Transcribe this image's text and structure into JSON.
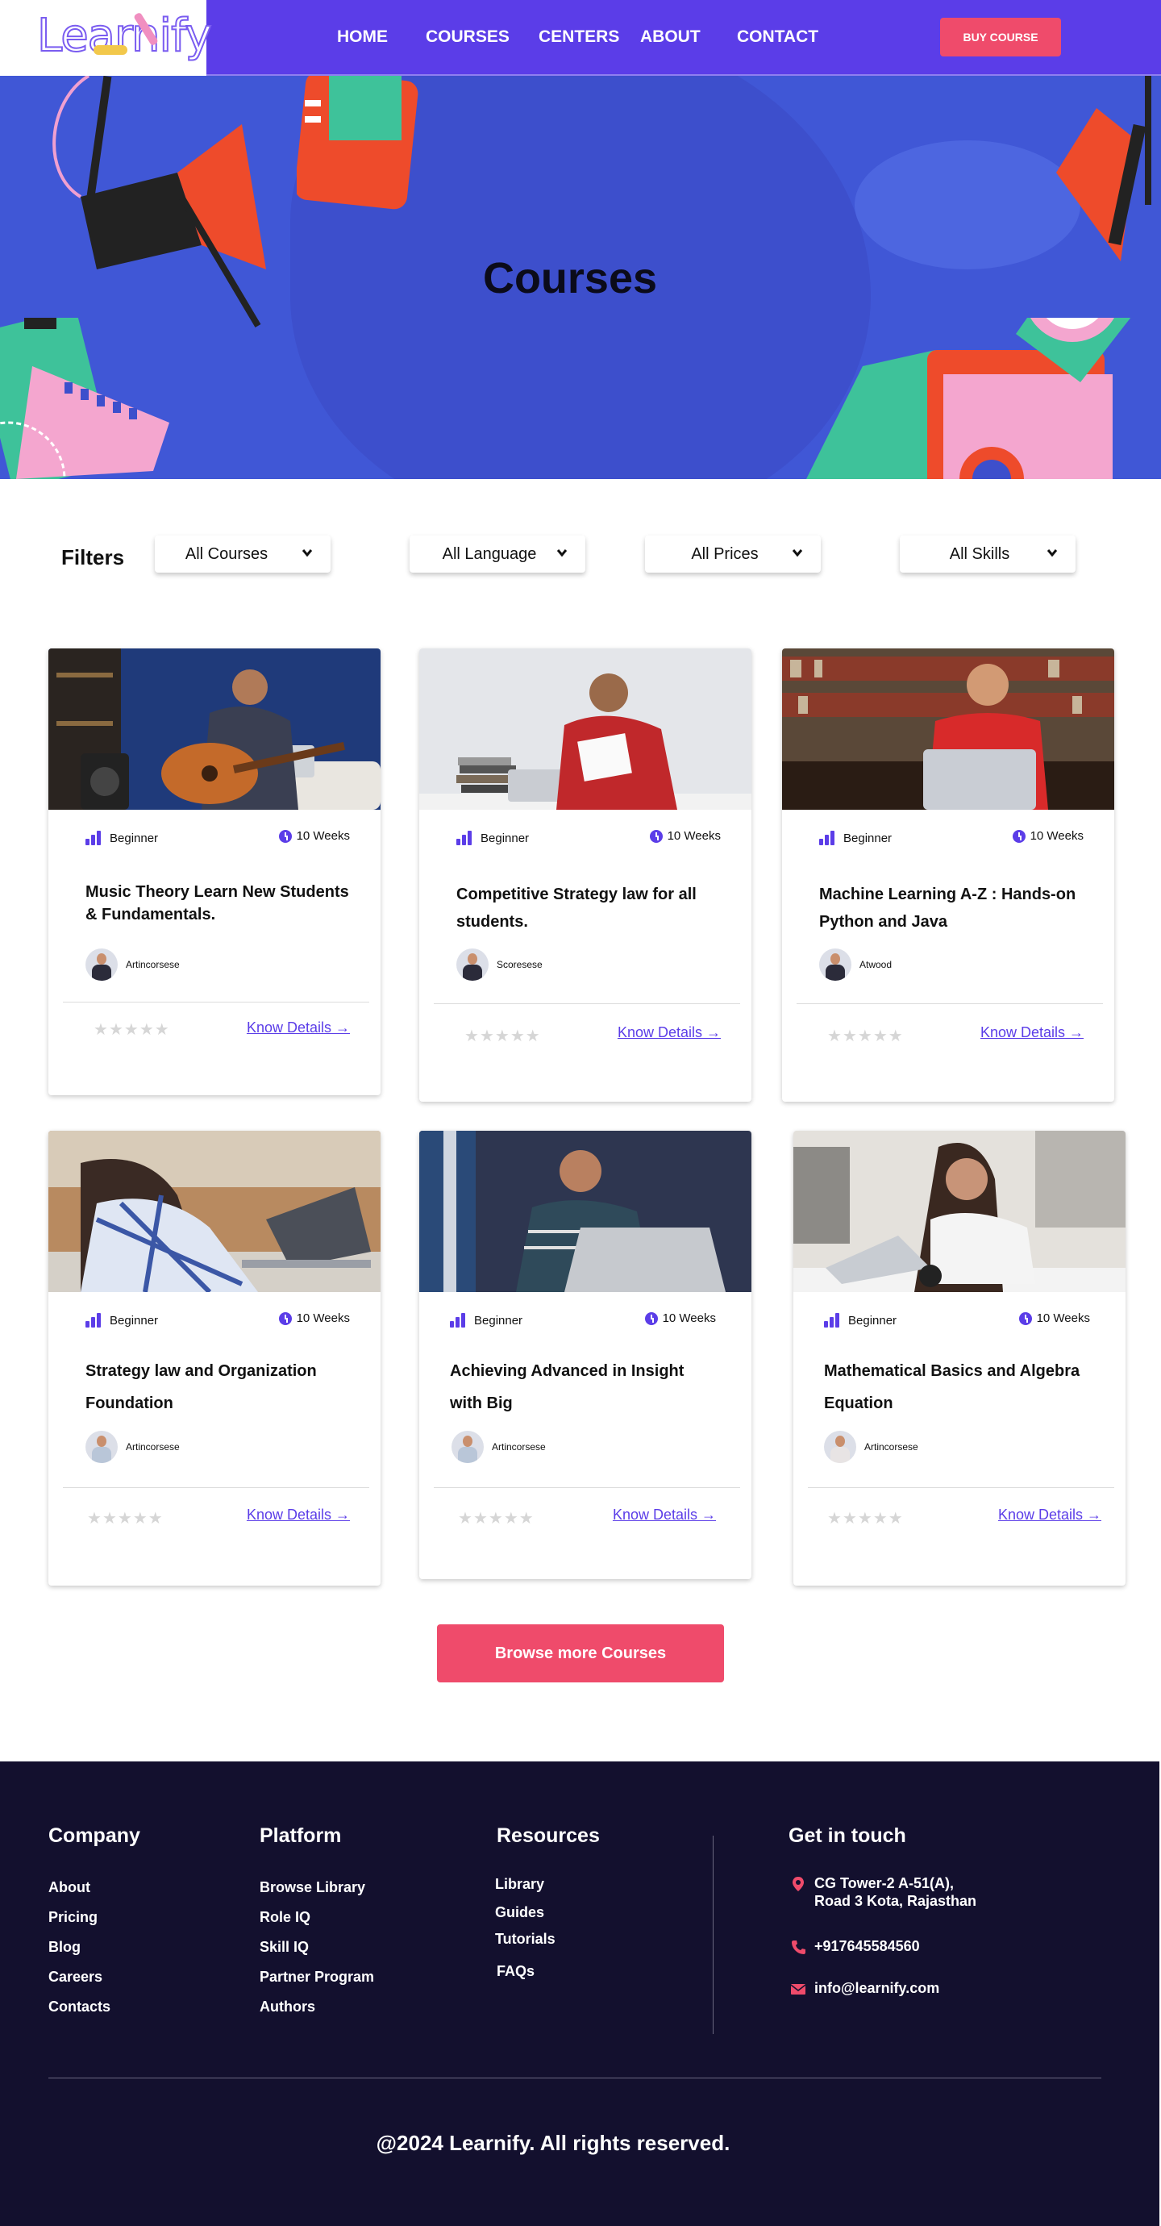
{
  "nav": {
    "logo": "Learnify",
    "links": [
      "HOME",
      "COURSES",
      "CENTERS",
      "ABOUT",
      "CONTACT"
    ],
    "cta": "BUY COURSE"
  },
  "hero": {
    "title": "Courses"
  },
  "filters": {
    "label": "Filters",
    "options": [
      "All Courses",
      "All Language",
      "All Prices",
      "All Skills"
    ]
  },
  "courses": [
    {
      "level": "Beginner",
      "duration": "10 Weeks",
      "title": "Music Theory Learn New Students & Fundamentals.",
      "author": "Artincorsese",
      "rating": 0,
      "link": "Know Details"
    },
    {
      "level": "Beginner",
      "duration": "10 Weeks",
      "title": "Competitive Strategy law for all students.",
      "author": "Scoresese",
      "rating": 0,
      "link": "Know Details"
    },
    {
      "level": "Beginner",
      "duration": "10 Weeks",
      "title": "Machine Learning A-Z : Hands-on Python and Java",
      "author": "Atwood",
      "rating": 0,
      "link": "Know Details"
    },
    {
      "level": "Beginner",
      "duration": "10 Weeks",
      "title": "Strategy law and Organization Foundation",
      "author": "Artincorsese",
      "rating": 0,
      "link": "Know Details"
    },
    {
      "level": "Beginner",
      "duration": "10 Weeks",
      "title": "Achieving Advanced in Insight with Big",
      "author": "Artincorsese",
      "rating": 0,
      "link": "Know Details"
    },
    {
      "level": "Beginner",
      "duration": "10 Weeks",
      "title": "Mathematical Basics and Algebra Equation",
      "author": "Artincorsese",
      "rating": 0,
      "link": "Know Details"
    }
  ],
  "browse_button": "Browse more Courses",
  "footer": {
    "company": {
      "heading": "Company",
      "links": [
        "About",
        "Pricing",
        "Blog",
        "Careers",
        "Contacts"
      ]
    },
    "platform": {
      "heading": "Platform",
      "links": [
        "Browse Library",
        "Role IQ",
        "Skill IQ",
        "Partner Program",
        "Authors"
      ]
    },
    "resources": {
      "heading": "Resources",
      "links": [
        "Library",
        "Guides",
        "Tutorials",
        "FAQs"
      ]
    },
    "contact": {
      "heading": "Get in touch",
      "address_line1": "CG Tower-2 A-51(A),",
      "address_line2": "Road 3 Kota, Rajasthan",
      "phone": "+917645584560",
      "email": "info@learnify.com"
    },
    "copyright": "@2024 Learnify. All rights reserved."
  },
  "colors": {
    "primary": "#5b3de8",
    "accent": "#ef4b6b",
    "hero_bg": "#4057d6",
    "footer_bg": "#13102e"
  },
  "icons": [
    "chevron-down-icon",
    "level-bars-icon",
    "clock-icon",
    "star-icon",
    "arrow-right-icon",
    "location-pin-icon",
    "phone-icon",
    "mail-icon"
  ]
}
